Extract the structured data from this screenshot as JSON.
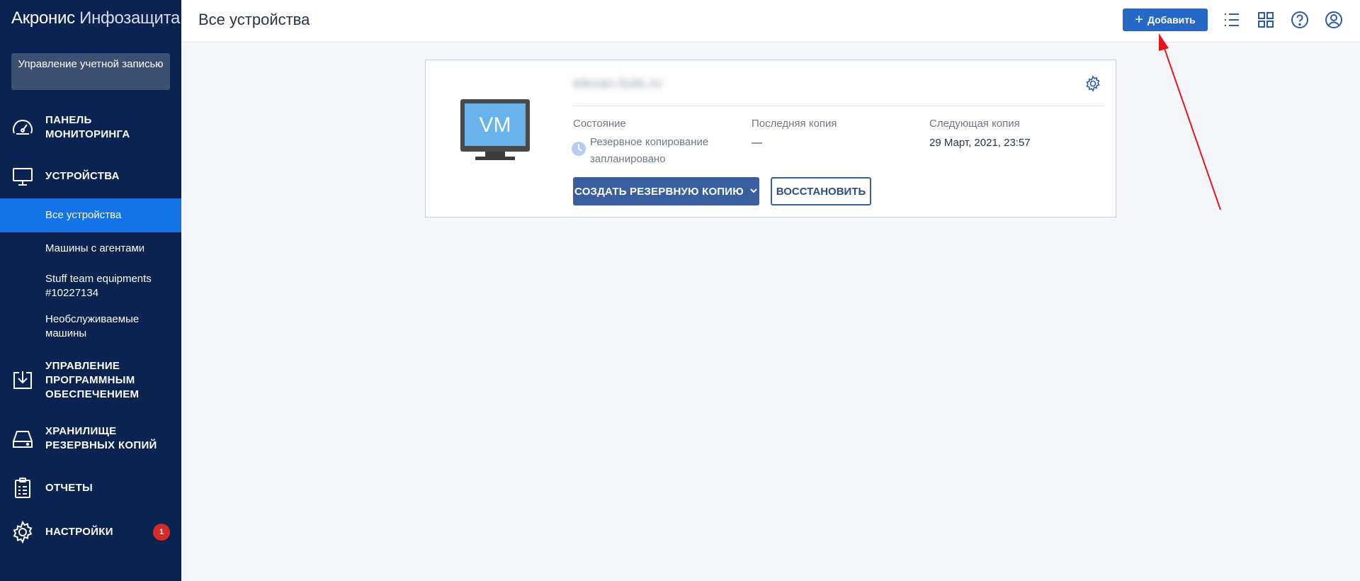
{
  "brand": {
    "bold": "Акронис",
    "light": "Инфозащита"
  },
  "sidebar": {
    "account_button": "Управление учетной записью",
    "items": [
      {
        "label": "Панель мониторинга",
        "icon": "dashboard-gauge-icon"
      },
      {
        "label": "Устройства",
        "icon": "monitor-icon"
      },
      {
        "label": "Управление программным обеспечением",
        "icon": "software-download-icon"
      },
      {
        "label": "Хранилище резервных копий",
        "icon": "storage-drive-icon"
      },
      {
        "label": "Отчеты",
        "icon": "clipboard-report-icon"
      },
      {
        "label": "Настройки",
        "icon": "gear-icon",
        "badge": "1"
      }
    ],
    "sub_items": [
      "Все устройства",
      "Машины с агентами",
      "Stuff team equipments #10227134",
      "Необслуживаемые машины"
    ]
  },
  "header": {
    "title": "Все устройства",
    "add_button": "Добавить"
  },
  "device_card": {
    "type_label": "VM",
    "hostname": "elevan.fods.ru",
    "columns": {
      "state_label": "Состояние",
      "state_value": "Резервное копирование запланировано",
      "last_label": "Последняя копия",
      "last_value": "—",
      "next_label": "Следующая копия",
      "next_value": "29 Март, 2021, 23:57"
    },
    "backup_button": "СОЗДАТЬ РЕЗЕРВНУЮ КОПИЮ",
    "restore_button": "ВОССТАНОВИТЬ"
  },
  "colors": {
    "sidebar_bg": "#0b2350",
    "active_item": "#1473e6",
    "primary_button": "#2668c5",
    "badge": "#d52a2a",
    "annotation_arrow": "#e8141c"
  }
}
